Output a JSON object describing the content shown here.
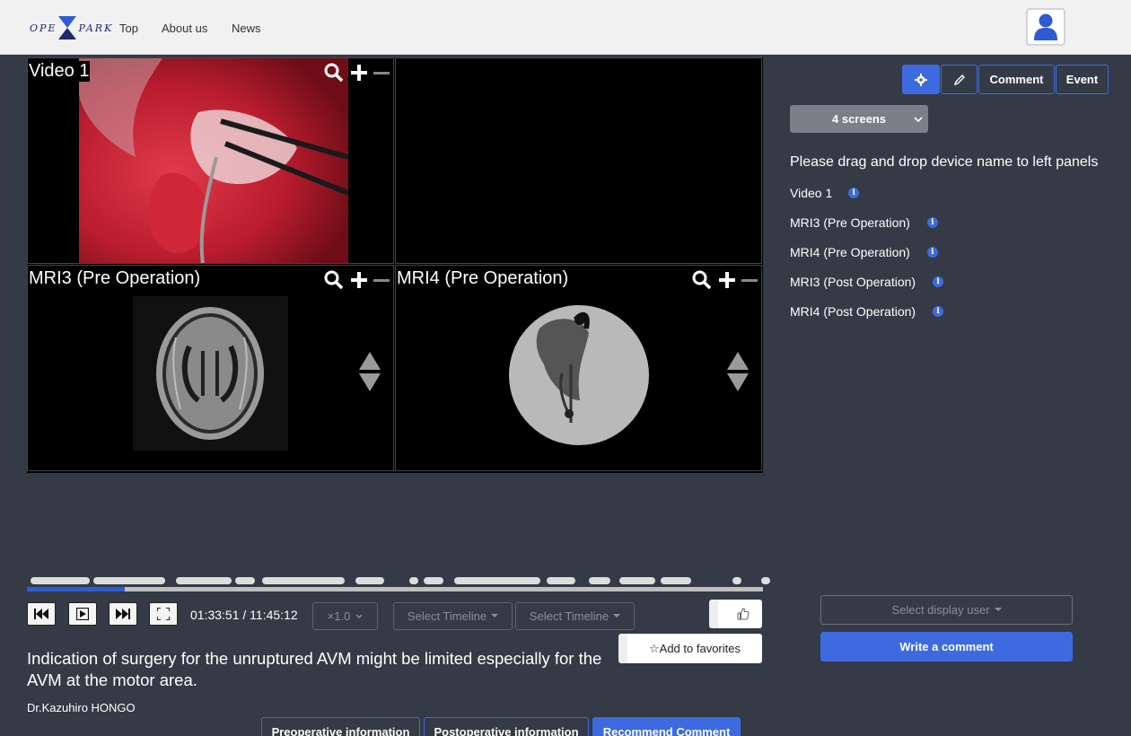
{
  "nav": {
    "logo_left": "OPE",
    "logo_right": "PARK",
    "links": [
      "Top",
      "About us",
      "News"
    ]
  },
  "panels": [
    {
      "title": "Video 1"
    },
    {
      "title": ""
    },
    {
      "title": "MRI3 (Pre Operation)"
    },
    {
      "title": "MRI4 (Pre Operation)"
    }
  ],
  "toolbar": {
    "comment_label": "Comment",
    "event_label": "Event"
  },
  "screens_select": "4 screens",
  "instruction": "Please drag and drop device name to left panels",
  "devices": [
    "Video 1",
    "MRI3 (Pre Operation)",
    "MRI4 (Pre Operation)",
    "MRI3 (Post Operation)",
    "MRI4 (Post Operation)"
  ],
  "player": {
    "time": "01:33:51 / 11:45:12",
    "progress_fraction": 0.133,
    "speed": "×1.0",
    "timeline1": "Select Timeline",
    "timeline2": "Select Timeline"
  },
  "favorites_label": "☆Add to favorites",
  "comment": {
    "text": "Indication of surgery for the unruptured AVM might be limited especially for the AVM at the motor area.",
    "author": "Dr.Kazuhiro HONGO"
  },
  "tabs": [
    "Preoperative information",
    "Postoperative information",
    "Recommend Comment"
  ],
  "select_user": "Select display user",
  "write_comment": "Write a comment",
  "colors": {
    "accent": "#3d6bdf",
    "background": "#343a46",
    "navbar": "#f1f1f2"
  }
}
